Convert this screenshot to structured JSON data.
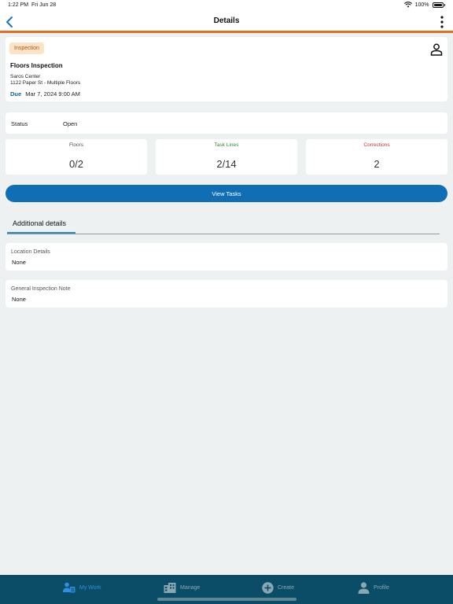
{
  "status_bar": {
    "time": "1:22 PM",
    "date": "Fri Jun 28",
    "battery": "100%",
    "icons": [
      "wifi-icon",
      "battery-icon"
    ]
  },
  "nav": {
    "title": "Details",
    "back_icon": "chevron-left-icon",
    "more_icon": "more-vertical-icon"
  },
  "inspection": {
    "badge": "Inspection",
    "title": "Floors Inspection",
    "location_name": "Saros Center",
    "address": "1122 Paper St - Multiple Floors",
    "due_label": "Due",
    "due_value": "Mar 7, 2024 9:00 AM",
    "assignee_icon": "person-icon"
  },
  "status": {
    "label": "Status",
    "value": "Open"
  },
  "metrics": [
    {
      "label": "Floors",
      "value": "0/2"
    },
    {
      "label": "Task Lines",
      "value": "2/14"
    },
    {
      "label": "Corrections",
      "value": "2"
    }
  ],
  "view_tasks_label": "View Tasks",
  "tabs": [
    {
      "label": "Additional details",
      "active": true
    }
  ],
  "details": [
    {
      "label": "Location Details",
      "value": "None"
    },
    {
      "label": "General Inspection Note",
      "value": "None"
    }
  ],
  "bottom_tabs": [
    {
      "label": "My Work",
      "icon": "my-work-icon",
      "active": true
    },
    {
      "label": "Manage",
      "icon": "building-icon",
      "active": false
    },
    {
      "label": "Create",
      "icon": "plus-circle-icon",
      "active": false
    },
    {
      "label": "Profile",
      "icon": "person-icon",
      "active": false
    }
  ],
  "colors": {
    "accent_orange": "#e0701f",
    "primary_blue": "#106fb4",
    "tab_bar": "#0b4d66",
    "task_lines_green": "#2e8b3a",
    "corrections_red": "#c0392b",
    "badge_bg": "#fde3c6"
  }
}
